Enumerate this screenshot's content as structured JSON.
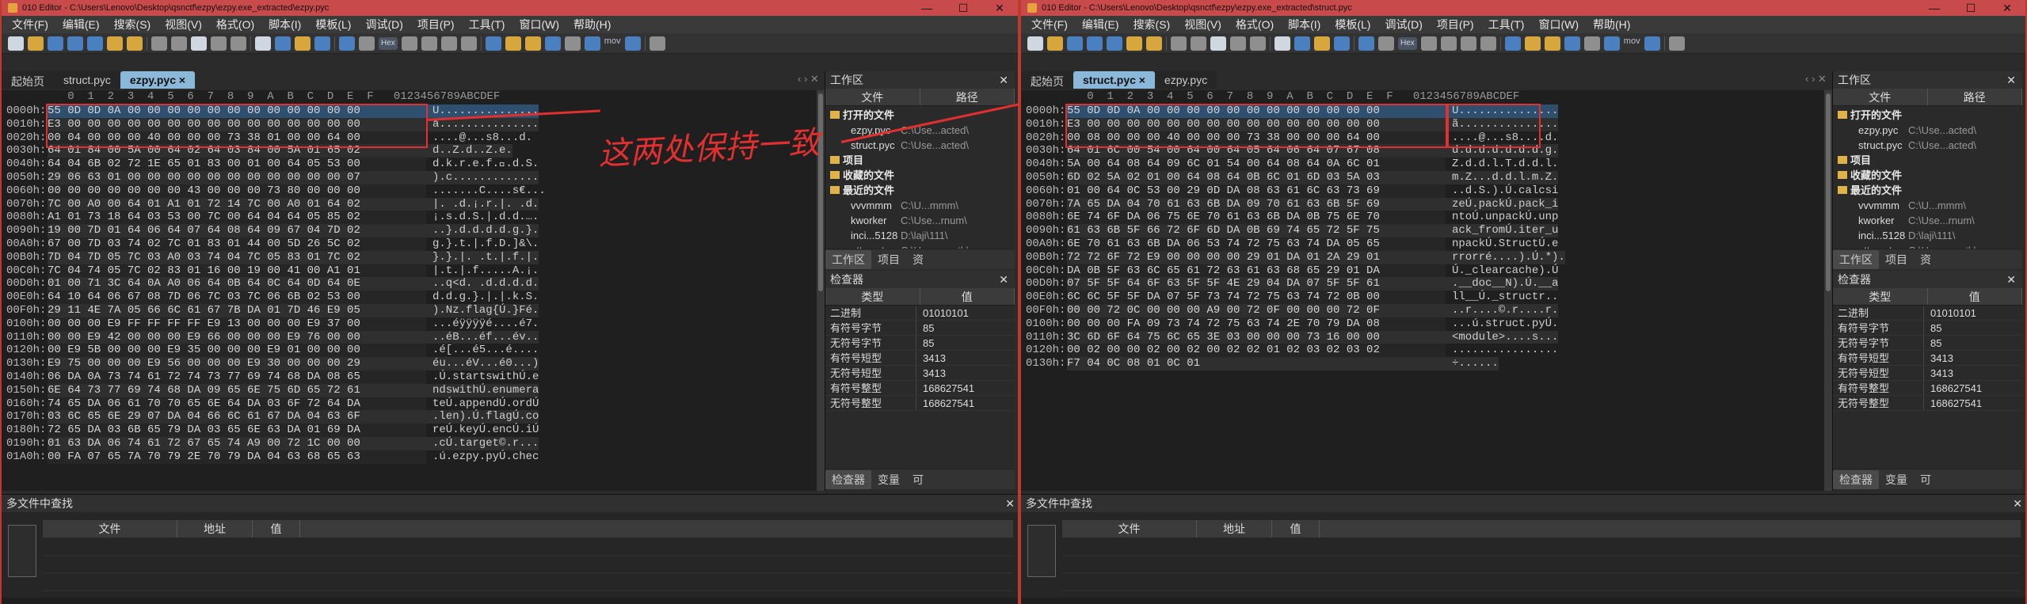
{
  "left": {
    "title": "010 Editor - C:\\Users\\Lenovo\\Desktop\\qsnctf\\ezpy\\ezpy.exe_extracted\\ezpy.pyc",
    "tabs": [
      {
        "label": "起始页"
      },
      {
        "label": "struct.pyc"
      },
      {
        "label": "ezpy.pyc ×"
      }
    ],
    "active_tab": 2,
    "rows": [
      [
        "0000h:",
        "55 0D 0D 0A 00 00 00 00 00 00 00 00 00 00 00 00",
        "U..............."
      ],
      [
        "0010h:",
        "E3 00 00 00 00 00 00 00 00 00 00 00 00 00 00 00",
        "ã..............."
      ],
      [
        "0020h:",
        "00 04 00 00 00 40 00 00 00 73 38 01 00 00 64 00",
        "....@...s8...d."
      ],
      [
        "0030h:",
        "64 01 84 00 5A 00 64 02 64 03 84 00 5A 01 65 02",
        "d..Z.d..Z.e."
      ],
      [
        "0040h:",
        "64 04 6B 02 72 1E 65 01 83 00 01 00 64 05 53 00",
        "d.k.r.e.f.\u0000.d.S."
      ],
      [
        "0050h:",
        "29 06 63 01 00 00 00 00 00 00 00 00 00 00 00 07",
        ").c............."
      ],
      [
        "0060h:",
        "00 00 00 00 00 00 00 43 00 00 00 73 80 00 00 00",
        ".......C....s€..."
      ],
      [
        "0070h:",
        "7C 00 A0 00 64 01 A1 01 72 14 7C 00 A0 01 64 02",
        "|. .d.¡.r.|. .d."
      ],
      [
        "0080h:",
        "A1 01 73 18 64 03 53 00 7C 00 64 04 64 05 85 02",
        "¡.s.d.S.|.d.d.…."
      ],
      [
        "0090h:",
        "19 00 7D 01 64 06 64 07 64 08 64 09 67 04 7D 02",
        "..}.d.d.d.d.g.}."
      ],
      [
        "00A0h:",
        "67 00 7D 03 74 02 7C 01 83 01 44 00 5D 26 5C 02",
        "g.}.t.|.f.D.]&\\."
      ],
      [
        "00B0h:",
        "7D 04 7D 05 7C 03 A0 03 74 04 7C 05 83 01 7C 02",
        "}.}.|. .t.|.f.|."
      ],
      [
        "00C0h:",
        "7C 04 74 05 7C 02 83 01 16 00 19 00 41 00 A1 01",
        "|.t.|.f.....A.¡."
      ],
      [
        "00D0h:",
        "01 00 71 3C 64 0A A0 06 64 0B 64 0C 64 0D 64 0E",
        "..q<d. .d.d.d.d."
      ],
      [
        "00E0h:",
        "64 10 64 06 67 08 7D 06 7C 03 7C 06 6B 02 53 00",
        "d.d.g.}.|.|.k.S."
      ],
      [
        "00F0h:",
        "29 11 4E 7A 05 66 6C 61 67 7B DA 01 7D 46 E9 05",
        ").Nz.flag{Ú.}Fé."
      ],
      [
        "0100h:",
        "00 00 00 E9 FF FF FF FF E9 13 00 00 00 E9 37 00",
        "...éÿÿÿÿé....é7."
      ],
      [
        "0110h:",
        "00 00 E9 42 00 00 00 E9 66 00 00 00 E9 76 00 00",
        "..éB...éf...év.."
      ],
      [
        "0120h:",
        "00 E9 5B 00 00 00 E9 35 00 00 00 E9 01 00 00 00",
        ".é[...é5...é...."
      ],
      [
        "0130h:",
        "E9 75 00 00 00 E9 56 00 00 00 E9 30 00 00 00 29",
        "éu...éV...é0...)"
      ],
      [
        "0140h:",
        "06 DA 0A 73 74 61 72 74 73 77 69 74 68 DA 08 65",
        ".Ú.startswithÚ.e"
      ],
      [
        "0150h:",
        "6E 64 73 77 69 74 68 DA 09 65 6E 75 6D 65 72 61",
        "ndswithÚ.enumera"
      ],
      [
        "0160h:",
        "74 65 DA 06 61 70 70 65 6E 64 DA 03 6F 72 64 DA",
        "teÚ.appendÚ.ordÚ"
      ],
      [
        "0170h:",
        "03 6C 65 6E 29 07 DA 04 66 6C 61 67 DA 04 63 6F",
        ".len).Ú.flagÚ.co"
      ],
      [
        "0180h:",
        "72 65 DA 03 6B 65 79 DA 03 65 6E 63 DA 01 69 DA",
        "reÚ.keyÚ.encÚ.iÚ"
      ],
      [
        "0190h:",
        "01 63 DA 06 74 61 72 67 65 74 A9 00 72 1C 00 00",
        ".cÚ.target©.r..."
      ],
      [
        "01A0h:",
        "00 FA 07 65 7A 70 79 2E 70 79 DA 04 63 68 65 63",
        ".ú.ezpy.pyÚ.chec"
      ]
    ],
    "files": [
      {
        "name": "ezpy.pyc",
        "path": "C:\\Use...acted\\"
      },
      {
        "name": "struct.pyc",
        "path": "C:\\Use...acted\\"
      }
    ],
    "recent": [
      {
        "name": "vvvmmm",
        "path": "C:\\U...mmm\\"
      },
      {
        "name": "kworker",
        "path": "C:\\Use...rnum\\"
      },
      {
        "name": "inci...5128",
        "path": "D:\\laji\\111\\"
      },
      {
        "name": "attac...t.exe",
        "path": "C:\\Use... math\\"
      }
    ]
  },
  "right": {
    "title": "010 Editor - C:\\Users\\Lenovo\\Desktop\\qsnctf\\ezpy\\ezpy.exe_extracted\\struct.pyc",
    "tabs": [
      {
        "label": "起始页"
      },
      {
        "label": "struct.pyc ×"
      },
      {
        "label": "ezpy.pyc"
      }
    ],
    "active_tab": 1,
    "rows": [
      [
        "0000h:",
        "55 0D 0D 0A 00 00 00 00 00 00 00 00 00 00 00 00",
        "U..............."
      ],
      [
        "0010h:",
        "E3 00 00 00 00 00 00 00 00 00 00 00 00 00 00 00",
        "ã..............."
      ],
      [
        "0020h:",
        "00 08 00 00 00 40 00 00 00 73 38 00 00 00 64 00",
        "....@...s8....d."
      ],
      [
        "0030h:",
        "64 01 6C 00 54 00 64 00 64 05 64 06 64 07 67 08",
        "d.d.d.d.d.d.d.g."
      ],
      [
        "0040h:",
        "5A 00 64 08 64 09 6C 01 54 00 64 08 64 0A 6C 01",
        "Z.d.d.l.T.d.d.l."
      ],
      [
        "0050h:",
        "6D 02 5A 02 01 00 64 08 64 0B 6C 01 6D 03 5A 03",
        "m.Z...d.d.l.m.Z."
      ],
      [
        "0060h:",
        "01 00 64 0C 53 00 29 0D DA 08 63 61 6C 63 73 69",
        "..d.S.).Ú.calcsi"
      ],
      [
        "0070h:",
        "7A 65 DA 04 70 61 63 6B DA 09 70 61 63 6B 5F 69",
        "zeÚ.packÚ.pack_i"
      ],
      [
        "0080h:",
        "6E 74 6F DA 06 75 6E 70 61 63 6B DA 0B 75 6E 70",
        "ntoÚ.unpackÚ.unp"
      ],
      [
        "0090h:",
        "61 63 6B 5F 66 72 6F 6D DA 0B 69 74 65 72 5F 75",
        "ack_fromÚ.iter_u"
      ],
      [
        "00A0h:",
        "6E 70 61 63 6B DA 06 53 74 72 75 63 74 DA 05 65",
        "npackÚ.StructÚ.e"
      ],
      [
        "00B0h:",
        "72 72 6F 72 E9 00 00 00 00 29 01 DA 01 2A 29 01",
        "rrorré....).Ú.*)."
      ],
      [
        "00C0h:",
        "DA 0B 5F 63 6C 65 61 72 63 61 63 68 65 29 01 DA",
        "Ú._clearcache).Ú"
      ],
      [
        "00D0h:",
        "07 5F 5F 64 6F 63 5F 5F 4E 29 04 DA 07 5F 5F 61",
        ".__doc__N).Ú.__a"
      ],
      [
        "00E0h:",
        "6C 6C 5F 5F DA 07 5F 73 74 72 75 63 74 72 0B 00",
        "ll__Ú._structr.."
      ],
      [
        "00F0h:",
        "00 00 72 0C 00 00 00 A9 00 72 0F 00 00 00 72 0F",
        "..r....©.r....r."
      ],
      [
        "0100h:",
        "00 00 00 FA 09 73 74 72 75 63 74 2E 70 79 DA 08",
        "...ú.struct.pyÚ."
      ],
      [
        "0110h:",
        "3C 6D 6F 64 75 6C 65 3E 03 00 00 00 73 16 00 00",
        "<module>....s..."
      ],
      [
        "0120h:",
        "00 02 00 00 02 00 02 00 02 02 01 02 03 02 03 02",
        "................"
      ],
      [
        "0130h:",
        "F7 04 0C 08 01 0C 01",
        "÷......"
      ]
    ],
    "files": [
      {
        "name": "ezpy.pyc",
        "path": "C:\\Use...acted\\"
      },
      {
        "name": "struct.pyc",
        "path": "C:\\Use...acted\\"
      }
    ],
    "recent": [
      {
        "name": "vvvmmm",
        "path": "C:\\U...mmm\\"
      },
      {
        "name": "kworker",
        "path": "C:\\Use...rnum\\"
      },
      {
        "name": "inci...5128",
        "path": "D:\\laji\\111\\"
      },
      {
        "name": "attac...t.exe",
        "path": "C:\\Use... math\\"
      }
    ]
  },
  "menu": [
    "文件(F)",
    "编辑(E)",
    "搜索(S)",
    "视图(V)",
    "格式(O)",
    "脚本(I)",
    "模板(L)",
    "调试(D)",
    "项目(P)",
    "工具(T)",
    "窗口(W)",
    "帮助(H)"
  ],
  "hex_header": "   0  1  2  3  4  5  6  7  8  9  A  B  C  D  E  F   0123456789ABCDEF",
  "tool_hex": "Hex",
  "tool_mov": "mov",
  "workspace": {
    "title": "工作区",
    "col_file": "文件",
    "col_path": "路径",
    "open_files": "打开的文件",
    "project": "项目",
    "favorites": "收藏的文件",
    "recent": "最近的文件",
    "tabs": [
      "工作区",
      "项目",
      "资"
    ]
  },
  "inspector": {
    "title": "检查器",
    "col_type": "类型",
    "col_value": "值",
    "rows": [
      {
        "k": "二进制",
        "v": "01010101"
      },
      {
        "k": "有符号字节",
        "v": "85"
      },
      {
        "k": "无符号字节",
        "v": "85"
      },
      {
        "k": "有符号短型",
        "v": "3413"
      },
      {
        "k": "无符号短型",
        "v": "3413"
      },
      {
        "k": "有符号整型",
        "v": "168627541"
      },
      {
        "k": "无符号整型",
        "v": "168627541"
      }
    ],
    "tabs": [
      "检查器",
      "变量",
      "可"
    ]
  },
  "mfs": {
    "title": "多文件中查找",
    "col_file": "文件",
    "col_addr": "地址",
    "col_value": "值"
  },
  "annotation": "这两处保持一致",
  "accent": "#e03030"
}
